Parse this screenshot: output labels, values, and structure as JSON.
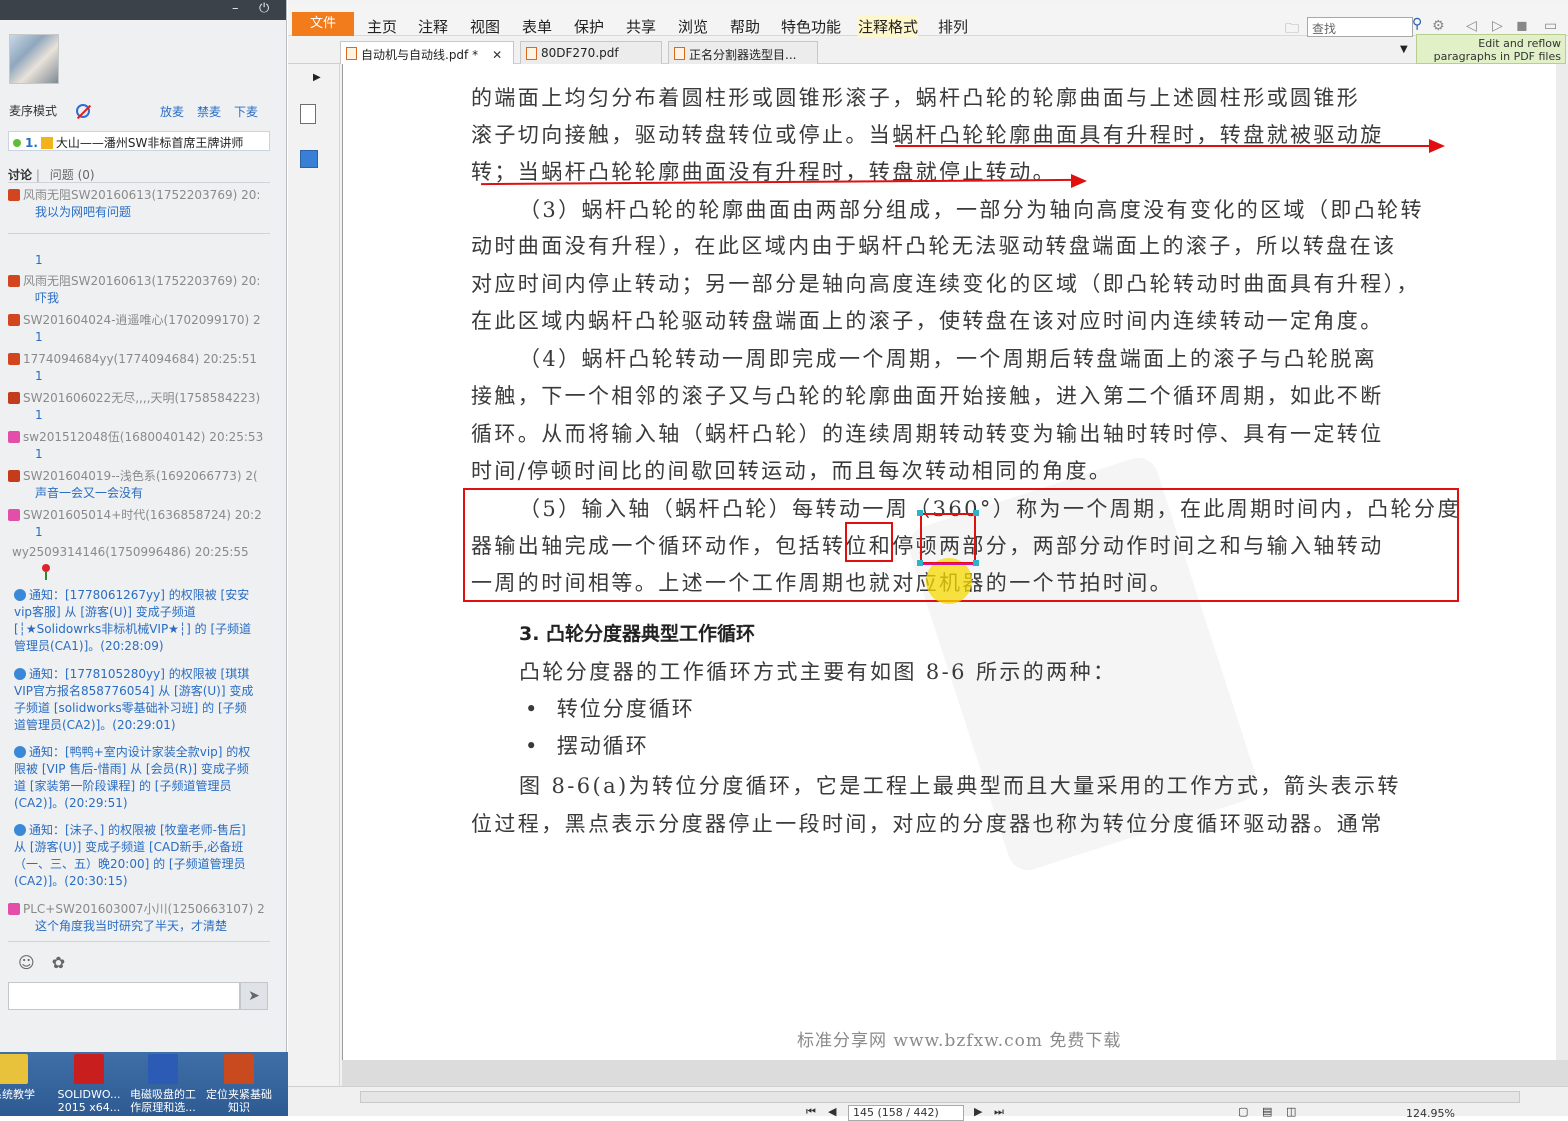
{
  "chat": {
    "mode_label": "麦序模式",
    "controls": [
      "放麦",
      "禁麦",
      "下麦"
    ],
    "mic_queue": {
      "index": "1.",
      "name": "大山——潘州SW非标首席王牌讲师"
    },
    "tabs": {
      "discussion": "讨论",
      "questions": "问题",
      "questions_count": "(0)"
    },
    "messages": [
      {
        "name": "风雨无阻SW20160613(1752203769) 20:",
        "body": "我以为网吧有问题",
        "color": "#d2451e"
      },
      {
        "name": "",
        "body": "1",
        "color": ""
      },
      {
        "name": "风雨无阻SW20160613(1752203769) 20:",
        "body": "吓我",
        "color": "#d2451e"
      },
      {
        "name": "SW201604024-逍遥唯心(1702099170) 2",
        "body": "1",
        "color": "#d2451e"
      },
      {
        "name": "1774094684yy(1774094684) 20:25:51",
        "body": "1",
        "color": "#d2451e"
      },
      {
        "name": "SW201606022无尽,,,,天明(1758584223)",
        "body": "1",
        "color": "#c43c1a"
      },
      {
        "name": "sw201512048伍(1680040142) 20:25:53",
        "body": "1",
        "color": "#e34fa8"
      },
      {
        "name": "SW201604019--浅色系(1692066773) 2(",
        "body": "声音一会又一会没有",
        "color": "#c43c1a"
      },
      {
        "name": "SW201605014+时代(1636858724) 20:2",
        "body": "1",
        "color": "#e34fa8"
      },
      {
        "name": "wy2509314146(1750996486) 20:25:55",
        "body": "",
        "color": ""
      }
    ],
    "notices": [
      "通知：[1778061267yy] 的权限被 [安安vip客服] 从 [游客(U)] 变成子频道 [┆★Solidowrks非标机械VIP★┆] 的 [子频道管理员(CA1)]。(20:28:09)",
      "通知：[1778105280yy] 的权限被 [琪琪VIP官方报名858776054] 从 [游客(U)] 变成子频道 [solidworks零基础补习班] 的 [子频道管理员(CA2)]。(20:29:01)",
      "通知：[鸭鸭+室内设计家装全款vip] 的权限被 [VIP 售后-惜雨] 从 [会员(R)] 变成子频道 [家装第一阶段课程] 的 [子频道管理员(CA2)]。(20:29:51)",
      "通知：[沫子、] 的权限被 [牧童老师-售后] 从 [游客(U)] 变成子频道 [CAD新手,必备班（一、三、五）晚20:00] 的 [子频道管理员(CA2)]。(20:30:15)"
    ],
    "last_message": {
      "name": "PLC+SW201603007小川(1250663107) 2",
      "body": "这个角度我当时研究了半天，才清楚",
      "color": "#e34fa8"
    },
    "input_value": ""
  },
  "taskbar": {
    "items": [
      {
        "label": "系统教学",
        "color": "#e8c23a"
      },
      {
        "label": "SOLIDWO... 2015 x64...",
        "color": "#c81e1e"
      },
      {
        "label": "电磁吸盘的工作原理和选...",
        "color": "#2b5bb5"
      },
      {
        "label": "定位夹紧基础知识",
        "color": "#c84a1e"
      }
    ]
  },
  "app": {
    "file_menu": "文件",
    "menus": [
      "主页",
      "注释",
      "视图",
      "表单",
      "保护",
      "共享",
      "浏览",
      "帮助",
      "特色功能",
      "注释格式",
      "排列"
    ],
    "search_placeholder": "查找",
    "ad_text": "Edit and reflow paragraphs in PDF files",
    "tabs": [
      {
        "label": "自动机与自动线.pdf *",
        "active": true,
        "closable": true
      },
      {
        "label": "80DF270.pdf",
        "active": false,
        "closable": false
      },
      {
        "label": "正名分割器选型目...",
        "active": false,
        "closable": false
      }
    ]
  },
  "document": {
    "lines": [
      "的端面上均匀分布着圆柱形或圆锥形滚子，蜗杆凸轮的轮廓曲面与上述圆柱形或圆锥形",
      "滚子切向接触，驱动转盘转位或停止。当蜗杆凸轮轮廓曲面具有升程时，转盘就被驱动旋",
      "转；当蜗杆凸轮轮廓曲面没有升程时，转盘就停止转动。",
      "（3）蜗杆凸轮的轮廓曲面由两部分组成，一部分为轴向高度没有变化的区域（即凸轮转",
      "动时曲面没有升程），在此区域内由于蜗杆凸轮无法驱动转盘端面上的滚子，所以转盘在该",
      "对应时间内停止转动；另一部分是轴向高度连续变化的区域（即凸轮转动时曲面具有升程），",
      "在此区域内蜗杆凸轮驱动转盘端面上的滚子，使转盘在该对应时间内连续转动一定角度。",
      "（4）蜗杆凸轮转动一周即完成一个周期，一个周期后转盘端面上的滚子与凸轮脱离",
      "接触，下一个相邻的滚子又与凸轮的轮廓曲面开始接触，进入第二个循环周期，如此不断",
      "循环。从而将输入轴（蜗杆凸轮）的连续周期转动转变为输出轴时转时停、具有一定转位",
      "时间/停顿时间比的间歇回转运动，而且每次转动相同的角度。",
      "（5）输入轴（蜗杆凸轮）每转动一周（360°）称为一个周期，在此周期时间内，凸轮分度",
      "器输出轴完成一个循环动作，包括转位和停顿两部分，两部分动作时间之和与输入轴转动",
      "一周的时间相等。上述一个工作周期也就对应机器的一个节拍时间。"
    ],
    "heading": "3. 凸轮分度器典型工作循环",
    "intro": "凸轮分度器的工作循环方式主要有如图 8-6 所示的两种：",
    "bullets": [
      "转位分度循环",
      "摆动循环"
    ],
    "tail": [
      "图 8-6(a)为转位分度循环，它是工程上最典型而且大量采用的工作方式，箭头表示转",
      "位过程，黑点表示分度器停止一段时间，对应的分度器也称为转位分度循环驱动器。通常"
    ],
    "footer": "标准分享网 www.bzfxw.com 免费下载"
  },
  "status": {
    "page_indicator": "145 (158 / 442)",
    "zoom": "124.95%"
  }
}
